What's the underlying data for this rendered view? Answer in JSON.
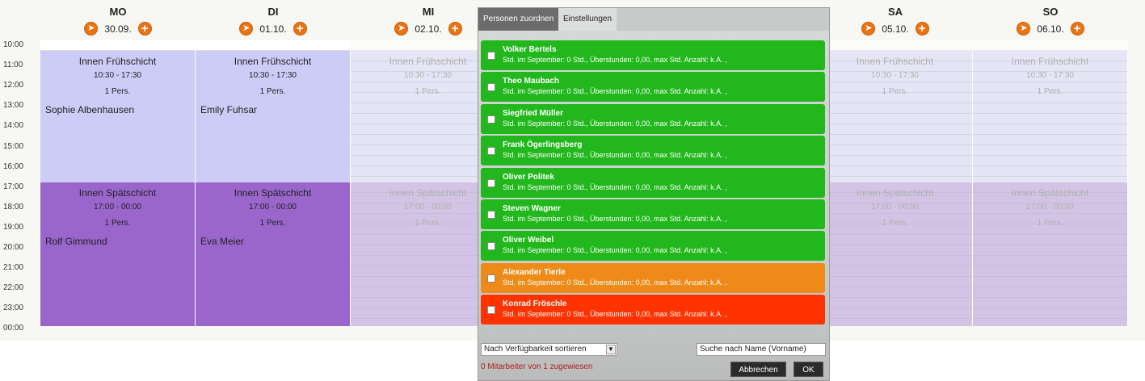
{
  "days": [
    {
      "name": "MO",
      "date": "30.09.",
      "early_person": "Sophie Albenhausen",
      "late_person": "Rolf Gimmund"
    },
    {
      "name": "DI",
      "date": "01.10.",
      "early_person": "Emily Fuhsar",
      "late_person": "Eva Meier"
    },
    {
      "name": "MI",
      "date": "02.10.",
      "early_person": "",
      "late_person": ""
    },
    {
      "name": "SA",
      "date": "05.10.",
      "early_person": "",
      "late_person": ""
    },
    {
      "name": "SO",
      "date": "06.10.",
      "early_person": "",
      "late_person": ""
    }
  ],
  "times": [
    "10:00",
    "11:00",
    "12:00",
    "13:00",
    "14:00",
    "15:00",
    "16:00",
    "17:00",
    "18:00",
    "19:00",
    "20:00",
    "21:00",
    "22:00",
    "23:00",
    "00:00"
  ],
  "shifts": {
    "early": {
      "title": "Innen Frühschicht",
      "time": "10:30 - 17:30",
      "pers": "1 Pers."
    },
    "late": {
      "title": "Innen Spätschicht",
      "time": "17:00 - 00:00",
      "pers": "1 Pers."
    }
  },
  "popup": {
    "tabs": [
      "Personen zuordnen",
      "Einstellungen"
    ],
    "persons": [
      {
        "name": "Volker Bertels",
        "info": "Std. im September: 0 Std., Überstunden: 0,00, max Std. Anzahl: k.A. ,",
        "status": "green"
      },
      {
        "name": "Theo Maubach",
        "info": "Std. im September: 0 Std., Überstunden: 0,00, max Std. Anzahl: k.A. ,",
        "status": "green"
      },
      {
        "name": "Siegfried Müller",
        "info": "Std. im September: 0 Std., Überstunden: 0,00, max Std. Anzahl: k.A. ,",
        "status": "green"
      },
      {
        "name": "Frank Ögerlingsberg",
        "info": "Std. im September: 0 Std., Überstunden: 0,00, max Std. Anzahl: k.A. ,",
        "status": "green"
      },
      {
        "name": "Oliver Politek",
        "info": "Std. im September: 0 Std., Überstunden: 0,00, max Std. Anzahl: k.A. ,",
        "status": "green"
      },
      {
        "name": "Steven Wagner",
        "info": "Std. im September: 0 Std., Überstunden: 0,00, max Std. Anzahl: k.A. ,",
        "status": "green"
      },
      {
        "name": "Oliver Weibel",
        "info": "Std. im September: 0 Std., Überstunden: 0,00, max Std. Anzahl: k.A. ,",
        "status": "green"
      },
      {
        "name": "Alexander Tierle",
        "info": "Std. im September: 0 Std., Überstunden: 0,00, max Std. Anzahl: k.A. ,",
        "status": "orange"
      },
      {
        "name": "Konrad Fröschle",
        "info": "Std. im September: 0 Std., Überstunden: 0,00, max Std. Anzahl: k.A. ,",
        "status": "red"
      }
    ],
    "sort_label": "Nach Verfügbarkeit sortieren",
    "search_placeholder": "Suche nach Name (Vorname)",
    "assigned_text": "0 Mitarbeiter von 1 zugewiesen",
    "cancel_label": "Abbrechen",
    "ok_label": "OK"
  },
  "colors": {
    "green": "#22b71c",
    "orange": "#ee8a18",
    "red": "#ff3300",
    "accent": "#e87414"
  }
}
